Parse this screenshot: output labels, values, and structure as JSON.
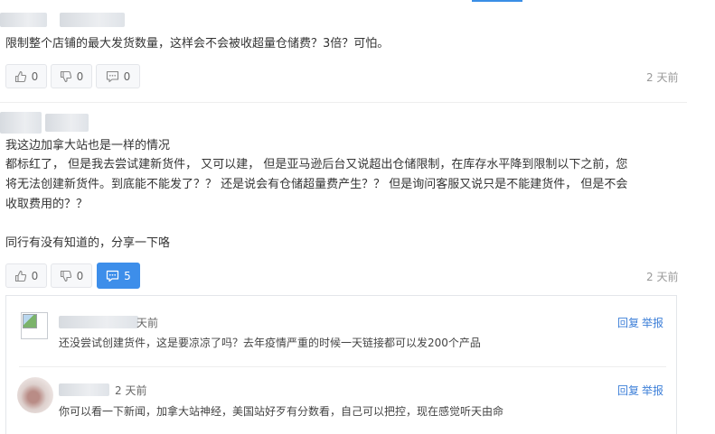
{
  "comment1": {
    "text": "限制整个店铺的最大发货数量，这样会不会被收超量仓储费？3倍？可怕。",
    "likes": "0",
    "dislikes": "0",
    "replies": "0",
    "time": "2 天前"
  },
  "comment2": {
    "lines": [
      "我这边加拿大站也是一样的情况",
      "都标红了，  但是我去尝试建新货件，  又可以建，  但是亚马逊后台又说超出仓储限制，在库存水平降到限制以下之前，您",
      "将无法创建新货件。到底能不能发了？？  还是说会有仓储超量费产生？？  但是询问客服又说只是不能建货件，  但是不会",
      "收取费用的？？",
      "",
      "同行有没有知道的，分享一下咯"
    ],
    "likes": "0",
    "dislikes": "0",
    "replies": "5",
    "time": "2 天前"
  },
  "replies": [
    {
      "time": "天前",
      "text": "还没尝试创建货件，这是要凉凉了吗？去年疫情严重的时候一天链接都可以发200个产品",
      "reply_label": "回复",
      "report_label": "举报"
    },
    {
      "time": "2 天前",
      "text": "你可以看一下新闻，加拿大站神经，美国站好歹有分数看，自己可以把控，现在感觉听天由命",
      "reply_label": "回复",
      "report_label": "举报"
    }
  ],
  "colors": {
    "accent": "#3d8eea",
    "link": "#3d7fd8",
    "muted": "#999999"
  }
}
